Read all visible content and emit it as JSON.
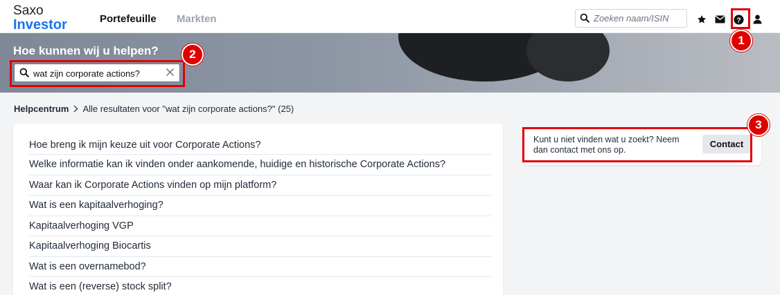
{
  "header": {
    "logo_line1": "Saxo",
    "logo_line2": "Investor",
    "nav_tabs": [
      {
        "label": "Portefeuille",
        "active": true
      },
      {
        "label": "Markten",
        "active": false
      }
    ],
    "search_placeholder": "Zoeken naam/ISIN",
    "icons": [
      "star-icon",
      "mail-icon",
      "help-icon",
      "user-icon"
    ]
  },
  "banner": {
    "title": "Hoe kunnen wij u helpen?",
    "search_value": "wat zijn corporate actions?"
  },
  "breadcrumb": {
    "root": "Helpcentrum",
    "current": "Alle resultaten voor \"wat zijn corporate actions?\" (25)"
  },
  "results": [
    "Hoe breng ik mijn keuze uit voor Corporate Actions?",
    "Welke informatie kan ik vinden onder aankomende, huidige en historische Corporate Actions?",
    "Waar kan ik Corporate Actions vinden op mijn platform?",
    "Wat is een kapitaalverhoging?",
    "Kapitaalverhoging VGP",
    "Kapitaalverhoging Biocartis",
    "Wat is een overnamebod?",
    "Wat is een (reverse) stock split?"
  ],
  "contact": {
    "text": "Kunt u niet vinden wat u zoekt? Neem dan contact met ons op.",
    "button_label": "Contact"
  },
  "annotations": [
    {
      "label": "1"
    },
    {
      "label": "2"
    },
    {
      "label": "3"
    }
  ],
  "colors": {
    "brand_blue": "#1a73e8",
    "annotation_red": "#e00000"
  }
}
